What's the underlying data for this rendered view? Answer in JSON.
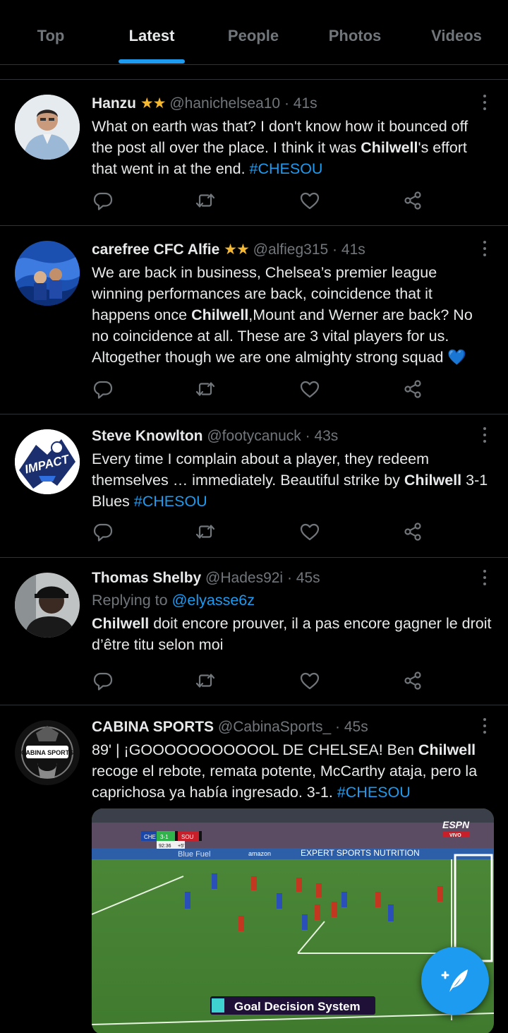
{
  "tabs": [
    "Top",
    "Latest",
    "People",
    "Photos",
    "Videos"
  ],
  "active_tab": "Latest",
  "tweets": [
    {
      "name": "Hanzu",
      "badge": "★★",
      "handle": "@hanichelsea10",
      "time": "41s",
      "text": [
        {
          "t": "What on earth was that? I don't know how it bounced off the post all over the place. I think it was "
        },
        {
          "t": "Chilwell",
          "b": true
        },
        {
          "t": "'s effort that went in at the end. "
        },
        {
          "t": "#CHESOU",
          "h": true
        }
      ]
    },
    {
      "name": "carefree CFC Alfie",
      "badge": "★★",
      "handle": "@alfieg315",
      "time": "41s",
      "text": [
        {
          "t": "We are back in business, Chelsea’s premier league winning performances are back, coincidence that it happens once "
        },
        {
          "t": "Chilwell",
          "b": true
        },
        {
          "t": ",Mount and Werner are back? No no coincidence at all. These are 3 vital players for us. Altogether though we are one almighty strong squad "
        },
        {
          "t": "💙",
          "e": true
        }
      ]
    },
    {
      "name": "Steve Knowlton",
      "badge": "",
      "handle": "@footycanuck",
      "time": "43s",
      "text": [
        {
          "t": "Every time I complain about a player, they redeem themselves … immediately.  Beautiful strike by "
        },
        {
          "t": "Chilwell",
          "b": true
        },
        {
          "t": " 3-1 Blues "
        },
        {
          "t": "#CHESOU",
          "h": true
        }
      ]
    },
    {
      "name": "Thomas Shelby",
      "badge": "",
      "handle": "@Hades92i",
      "time": "45s",
      "replying_prefix": "Replying to ",
      "replying_to": "@elyasse6z",
      "text": [
        {
          "t": "Chilwell",
          "b": true
        },
        {
          "t": " doit encore prouver, il a pas encore gagner le droit d’être titu selon moi"
        }
      ]
    },
    {
      "name": "CABINA SPORTS",
      "badge": "",
      "handle": "@CabinaSports_",
      "time": "45s",
      "text": [
        {
          "t": "89' | ¡GOOOOOOOOOOOL DE CHELSEA! Ben "
        },
        {
          "t": "Chilwell",
          "b": true
        },
        {
          "t": " recoge el rebote, remata potente, McCarthy ataja, pero la caprichosa ya había ingresado. 3-1. "
        },
        {
          "t": "#CHESOU",
          "h": true
        }
      ]
    }
  ],
  "media": {
    "scoreboard_home": "CHE",
    "scoreboard_score": "3-1",
    "scoreboard_away": "SOU",
    "scoreboard_clock": "92:36",
    "scoreboard_added": "+5'",
    "network": "ESPN",
    "network_sub": "VIVO",
    "board_left": "Blue Fuel",
    "board_mid": "amazon",
    "board_right": "EXPERT SPORTS NUTRITION",
    "caption": "Goal Decision System"
  },
  "avatar_texts": {
    "impact": "IMPACT",
    "cabina": "CABINA SPORTS"
  },
  "colors": {
    "accent": "#1d9bf0",
    "muted": "#71767b",
    "star": "#f5b82e",
    "background": "#000000"
  },
  "icons": [
    "reply-icon",
    "retweet-icon",
    "like-icon",
    "share-icon",
    "more-icon",
    "compose-icon"
  ]
}
